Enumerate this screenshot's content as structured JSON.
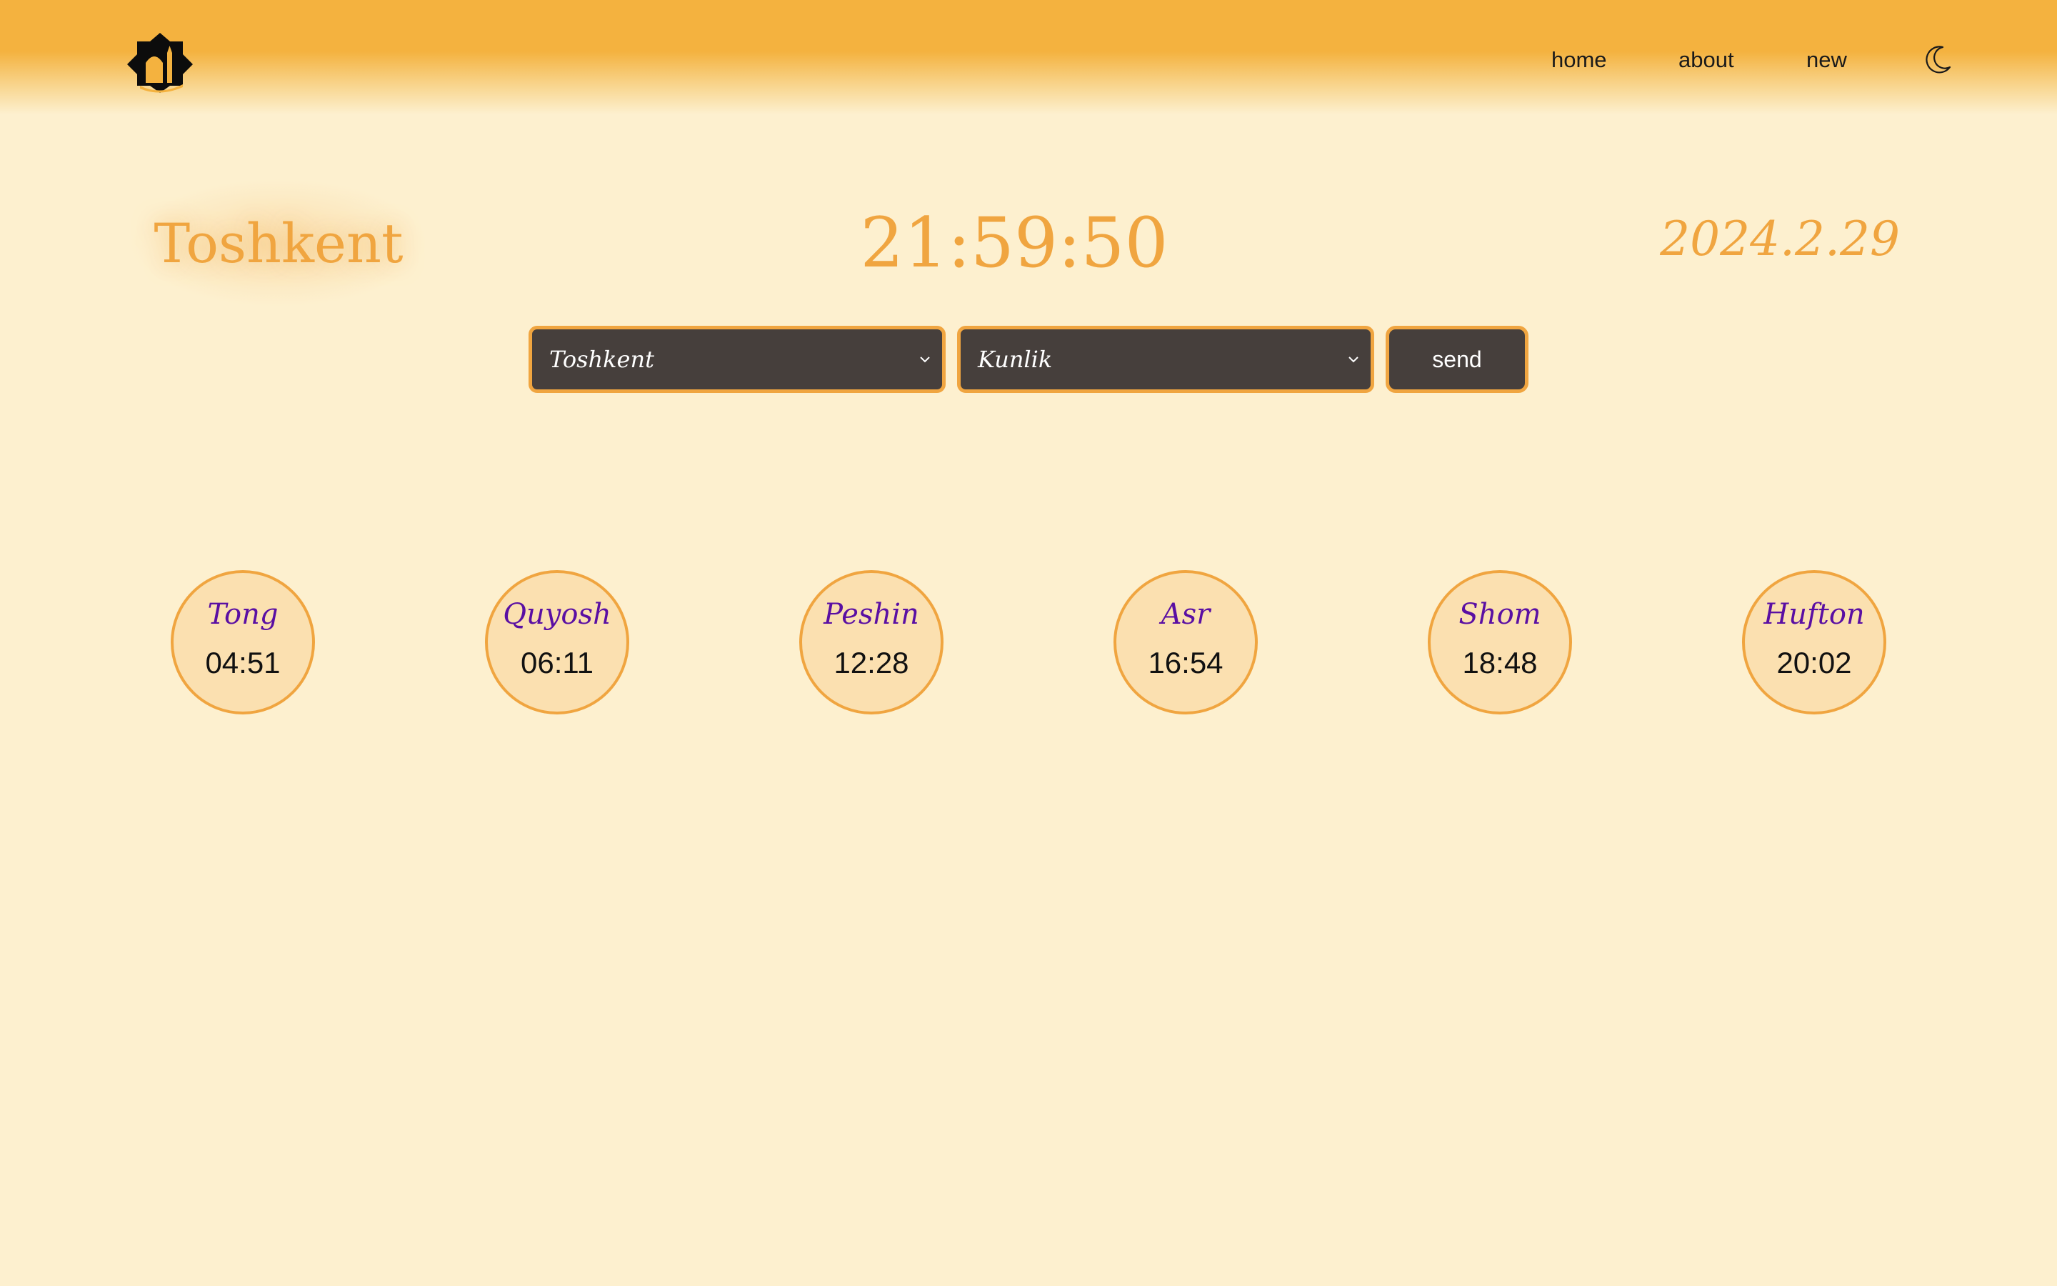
{
  "header": {
    "logo_icon": "mosque-icon",
    "nav": [
      {
        "label": "home"
      },
      {
        "label": "about"
      },
      {
        "label": "new"
      }
    ],
    "theme_toggle_icon": "moon-icon"
  },
  "hero": {
    "city": "Toshkent",
    "time": "21:59:50",
    "date": "2024.2.29"
  },
  "form": {
    "city_select": {
      "selected": "Toshkent"
    },
    "period_select": {
      "selected": "Kunlik"
    },
    "send_label": "send"
  },
  "prayers": [
    {
      "name": "Tong",
      "time": "04:51"
    },
    {
      "name": "Quyosh",
      "time": "06:11"
    },
    {
      "name": "Peshin",
      "time": "12:28"
    },
    {
      "name": "Asr",
      "time": "16:54"
    },
    {
      "name": "Shom",
      "time": "18:48"
    },
    {
      "name": "Hufton",
      "time": "20:02"
    }
  ],
  "colors": {
    "background": "#fdf0cf",
    "header": "#f4b23f",
    "accent": "#f0a540",
    "control_bg": "#463f3c",
    "prayer_name": "#5a0fa3"
  }
}
